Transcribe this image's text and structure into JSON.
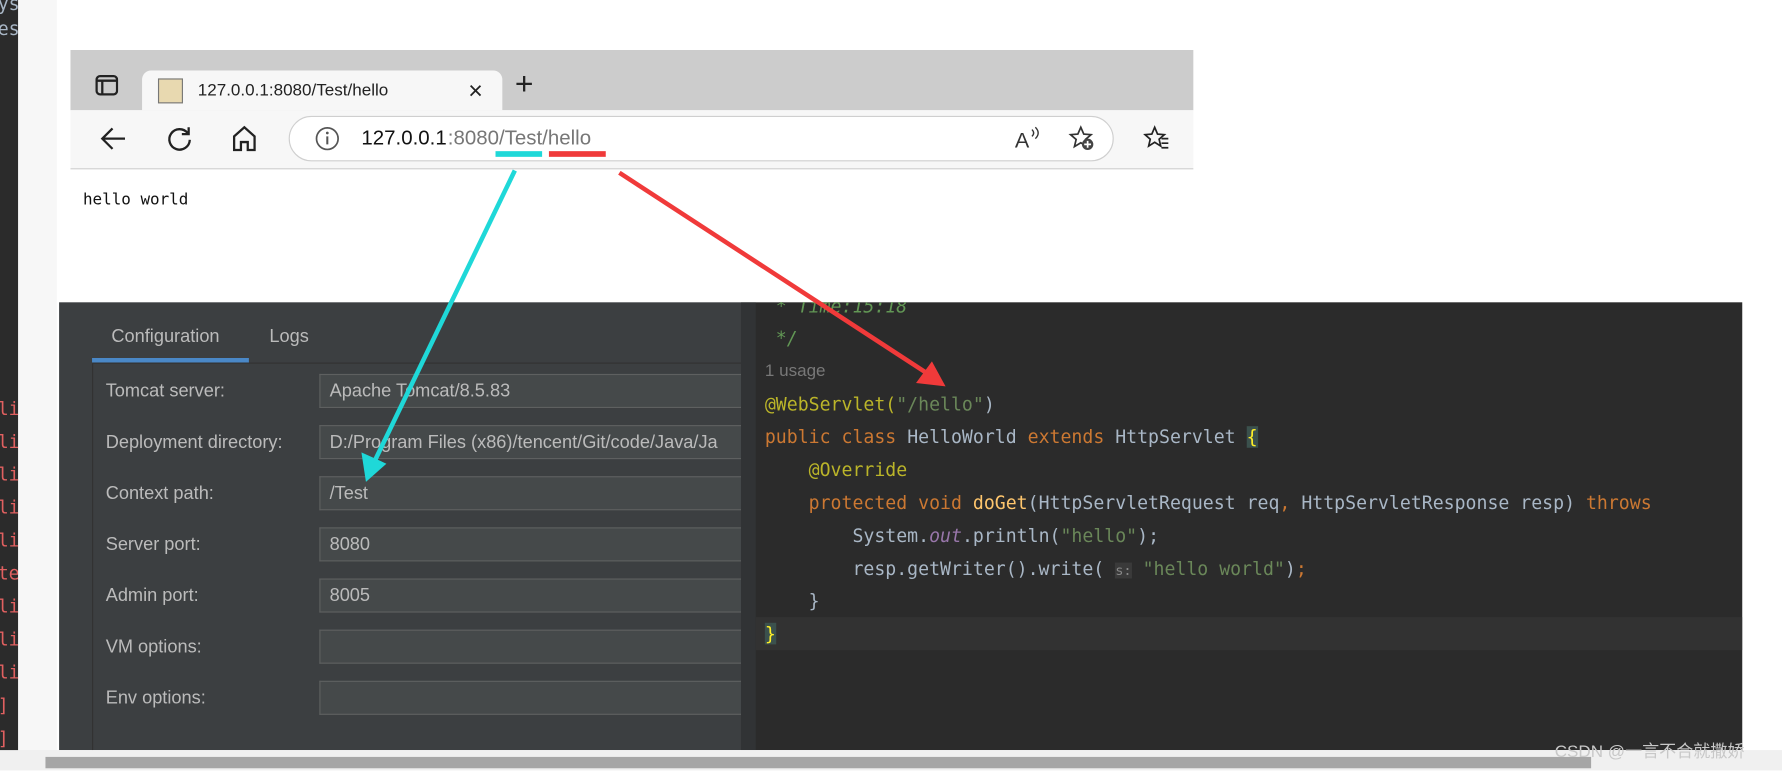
{
  "background_console": {
    "top_fragments": [
      "ys",
      "es"
    ],
    "red_fragments": [
      "li",
      "li",
      "li",
      "li",
      "li",
      "te",
      "li",
      "li",
      "li",
      "]",
      "]"
    ]
  },
  "browser": {
    "tab_title": "127.0.0.1:8080/Test/hello",
    "tab_close": "×",
    "new_tab": "+",
    "url_host": "127.0.0.1",
    "url_rest": ":8080/Test/hello",
    "page_text": "hello world",
    "icons": [
      "tab-actions-icon",
      "tomcat-favicon",
      "back-icon",
      "refresh-icon",
      "home-icon",
      "info-icon",
      "read-aloud-icon",
      "add-favorite-icon",
      "favorites-icon"
    ]
  },
  "annotations": {
    "context_underline_color": "#1fd8d8",
    "servlet_underline_color": "#f03a3a"
  },
  "run_config": {
    "tabs": [
      {
        "label": "Configuration",
        "active": true
      },
      {
        "label": "Logs",
        "active": false
      }
    ],
    "fields": [
      {
        "label": "Tomcat server:",
        "value": "Apache Tomcat/8.5.83"
      },
      {
        "label": "Deployment directory:",
        "value": "D:/Program Files (x86)/tencent/Git/code/Java/Ja"
      },
      {
        "label": "Context path:",
        "value": "/Test"
      },
      {
        "label": "Server port:",
        "value": "8080"
      },
      {
        "label": "Admin port:",
        "value": "8005"
      },
      {
        "label": "VM options:",
        "value": ""
      },
      {
        "label": "Env options:",
        "value": ""
      }
    ]
  },
  "code": {
    "comment_time": " * Time:15:18",
    "comment_end": " */",
    "usage_hint": "1 usage",
    "line_annotation": [
      "@WebServlet(",
      "\"/hello\"",
      ")"
    ],
    "line_class": [
      "public class ",
      "HelloWorld ",
      "extends ",
      "HttpServlet ",
      "{"
    ],
    "line_override": "    @Override",
    "line_method": [
      "    protected void ",
      "doGet",
      "(HttpServletRequest req",
      ", ",
      "HttpServletResponse resp) ",
      "throws"
    ],
    "line_println": [
      "        System.",
      "out",
      ".println(",
      "\"hello\"",
      ");"
    ],
    "line_write": [
      "        resp.getWriter().write( ",
      "s:",
      " \"hello world\"",
      ")",
      ";"
    ],
    "line_close_method": "    }",
    "line_close_class": "}"
  },
  "watermark": "CSDN @一言不合就撒娇"
}
